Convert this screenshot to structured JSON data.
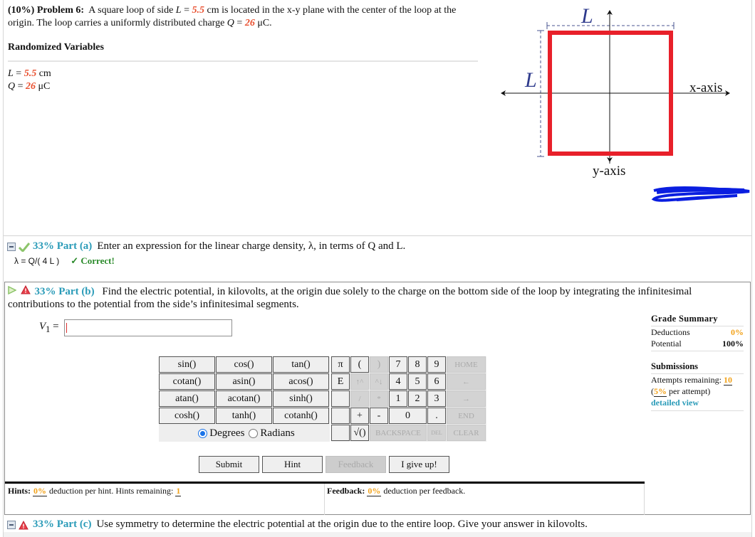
{
  "problem": {
    "percent": "(10%)",
    "label": "Problem 6:",
    "text_1": "A square loop of side",
    "L_symbol": "L",
    "eq": "=",
    "L_value": "5.5",
    "L_unit": "cm is located in the x-y plane with the center of the loop at the origin. The loop carries a uniformly distributed charge",
    "Q_symbol": "Q",
    "Q_value": "26",
    "Q_unit": "μC."
  },
  "randomized": {
    "title": "Randomized Variables",
    "vars": [
      {
        "symbol": "L",
        "eq": "=",
        "value": "5.5",
        "unit": "cm"
      },
      {
        "symbol": "Q",
        "eq": "=",
        "value": "26",
        "unit": "μC"
      }
    ]
  },
  "diagram": {
    "label_top": "L",
    "label_left": "L",
    "x_axis": "x-axis",
    "y_axis": "y-axis",
    "loop_color": "#e8202a",
    "label_color": "#2e3a8c",
    "scribble_color": "#0a1ee0"
  },
  "part_a": {
    "percent": "33% Part (a)",
    "text": "Enter an expression for the linear charge density, λ, in terms of Q and L.",
    "answer": "λ = Q/( 4 L )",
    "status": "✓ Correct!"
  },
  "part_b": {
    "percent": "33% Part (b)",
    "text": "Find the electric potential, in kilovolts, at the origin due solely to the charge on the bottom side of the loop by integrating the infinitesimal contributions to the potential from the side’s infinitesimal segments.",
    "input_label": "V",
    "input_sub": "1",
    "input_eq": "=",
    "input_value": "",
    "grade_summary": {
      "title": "Grade Summary",
      "deductions_label": "Deductions",
      "deductions_value": "0%",
      "potential_label": "Potential",
      "potential_value": "100%"
    },
    "submissions": {
      "title": "Submissions",
      "attempts_label": "Attempts remaining:",
      "attempts_value": "10",
      "per_attempt_open": "(",
      "per_attempt_value": "5%",
      "per_attempt_text": "per attempt)",
      "detailed_view": "detailed view"
    },
    "keypad": {
      "functions": [
        "sin()",
        "cos()",
        "tan()",
        "cotan()",
        "asin()",
        "acos()",
        "atan()",
        "acotan()",
        "sinh()",
        "cosh()",
        "tanh()",
        "cotanh()"
      ],
      "degrees_label": "Degrees",
      "radians_label": "Radians",
      "angle_mode": "Degrees",
      "rows": [
        [
          "π",
          "(",
          ")",
          "7",
          "8",
          "9",
          "HOME"
        ],
        [
          "E",
          "↑^",
          "^↓",
          "4",
          "5",
          "6",
          "←"
        ],
        [
          "",
          "/",
          "*",
          "1",
          "2",
          "3",
          "→"
        ],
        [
          "",
          "+",
          "-",
          "0",
          ".",
          "END"
        ],
        [
          "",
          "√()",
          "BACKSPACE",
          "DEL",
          "CLEAR"
        ]
      ]
    },
    "buttons": {
      "submit": "Submit",
      "hint": "Hint",
      "feedback": "Feedback",
      "give_up": "I give up!"
    },
    "hints": {
      "label": "Hints:",
      "deduction": "0%",
      "text": "deduction per hint. Hints remaining:",
      "remaining": "1"
    },
    "feedback": {
      "label": "Feedback:",
      "deduction": "0%",
      "text": "deduction per feedback."
    }
  },
  "part_c": {
    "percent": "33% Part (c)",
    "text": "Use symmetry to determine the electric potential at the origin due to the entire loop. Give your answer in kilovolts."
  }
}
